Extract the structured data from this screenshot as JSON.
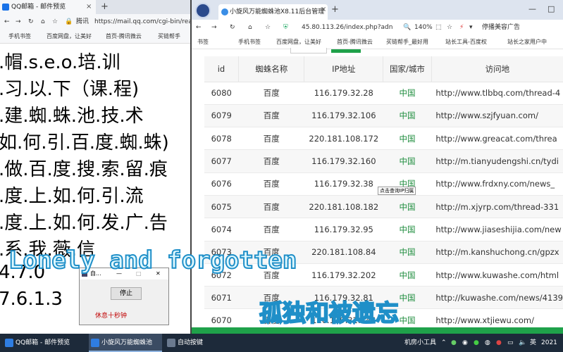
{
  "left_browser": {
    "tab_title": "QQ邮箱 - 邮件预览",
    "tab_close": "×",
    "new_tab": "+",
    "nav_back": "←",
    "nav_forward": "→",
    "nav_reload": "↻",
    "nav_home": "⌂",
    "nav_bookmark": "☆",
    "site_label": "腾讯",
    "url": "https://mail.qq.com/cgi-bin/rea",
    "bookmarks": [
      "手机书签",
      "百度网盘，让美好",
      "首页-腾讯微云",
      "买链帮手"
    ],
    "content_lines": [
      ".帽.s.e.o.培.训",
      ".习.以.下（课.程)",
      ".建.蜘.蛛.池.技.术",
      "如.何.引.百.度.蜘.蛛)",
      ".做.百.度.搜.索.留.痕",
      ".度.上.如.何.引.流",
      ".度.上.如.何.发.广.告",
      ".系.我.薇.信",
      "4.7.0",
      "7.6.1.3"
    ]
  },
  "dialog": {
    "title": "自...",
    "minimize": "—",
    "maximize": "□",
    "close": "✕",
    "stop_button": "停止",
    "status": "休息十秒钟"
  },
  "right_browser": {
    "tab_title": "小旋风万能蜘蛛池X8.11后台管理",
    "tab_close": "×",
    "new_tab": "+",
    "window_min": "—",
    "window_max": "□",
    "nav_back": "←",
    "nav_forward": "→",
    "nav_reload": "↻",
    "nav_home": "⌂",
    "nav_bookmark": "☆",
    "url": "45.80.113.26/index.php?adn",
    "zoom": "140%",
    "extra_label": "停播美容广告",
    "bookmarks": [
      "书签",
      "手机书签",
      "百度网盘，让美好",
      "首页-腾讯微云",
      "买链帮手_最好用",
      "站长工具-百度权",
      "站长之家用户中"
    ],
    "table": {
      "headers": [
        "id",
        "蜘蛛名称",
        "IP地址",
        "国家/城市",
        "访问地"
      ],
      "rows": [
        [
          "6080",
          "百度",
          "116.179.32.28",
          "中国",
          "http://www.tlbbq.com/thread-4"
        ],
        [
          "6079",
          "百度",
          "116.179.32.106",
          "中国",
          "http://www.szjfyuan.com/"
        ],
        [
          "6078",
          "百度",
          "220.181.108.172",
          "中国",
          "http://www.greacat.com/threa"
        ],
        [
          "6077",
          "百度",
          "116.179.32.160",
          "中国",
          "http://m.tianyudengshi.cn/tydi"
        ],
        [
          "6076",
          "百度",
          "116.179.32.38",
          "中国",
          "http://www.frdxny.com/news_"
        ],
        [
          "6075",
          "百度",
          "220.181.108.182",
          "中国",
          "http://m.xjyrp.com/thread-331"
        ],
        [
          "6074",
          "百度",
          "116.179.32.95",
          "中国",
          "http://www.jiaseshijia.com/new"
        ],
        [
          "6073",
          "百度",
          "220.181.108.84",
          "中国",
          "http://m.kanshuchong.cn/gpzx"
        ],
        [
          "6072",
          "百度",
          "116.179.32.202",
          "中国",
          "http://www.kuwashe.com/html"
        ],
        [
          "6071",
          "百度",
          "116.179.32.81",
          "中国",
          "http://kuwashe.com/news/4139"
        ],
        [
          "6070",
          "百度",
          "116.179.32.144",
          "中国",
          "http://www.xtjiewu.com/"
        ]
      ]
    },
    "tooltip": "点击查询IP归属"
  },
  "overlay": {
    "english": "Lonely and forgotten",
    "chinese": "孤独和被遗忘"
  },
  "taskbar": {
    "items": [
      "QQ邮箱 - 邮件预览",
      "小旋风万能蜘蛛池",
      "自动按键"
    ],
    "tray_label": "机房小工具",
    "clock": "2021"
  },
  "colors": {
    "accent_green": "#1fa14a",
    "country_green": "#1c8c3c",
    "status_red": "#c00000",
    "overlay_stroke": "#1f8fc8",
    "taskbar_bg": "#1d2a3a"
  }
}
